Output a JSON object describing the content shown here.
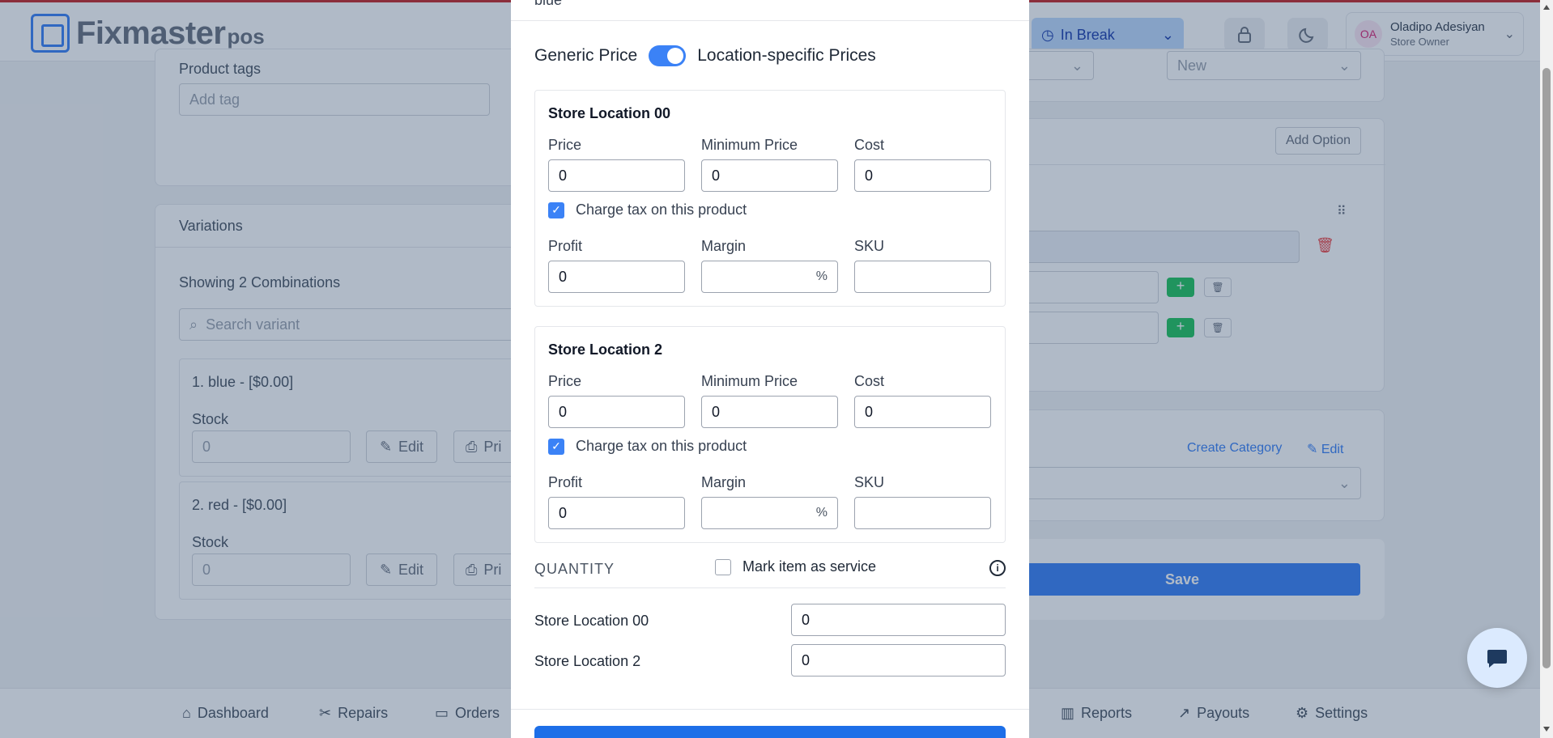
{
  "header": {
    "logo_text": "Fixmaster",
    "logo_suffix": "pos",
    "status": "In Break",
    "user": {
      "initials": "OA",
      "name": "Oladipo Adesiyan",
      "role": "Store Owner"
    }
  },
  "background": {
    "product_tags_label": "Product tags",
    "product_tags_placeholder": "Add tag",
    "condition_value": "New",
    "add_option_label": "Add Option",
    "variations_title": "Variations",
    "combinations_text": "Showing 2 Combinations",
    "search_placeholder": "Search variant",
    "variants": [
      {
        "name": "1. blue  -  [$0.00]",
        "stock_label": "Stock",
        "stock": "0",
        "edit": "Edit",
        "print": "Pri"
      },
      {
        "name": "2. red  -  [$0.00]",
        "stock_label": "Stock",
        "stock": "0",
        "edit": "Edit",
        "print": "Pri"
      }
    ],
    "create_category": "Create Category",
    "category_edit": "Edit",
    "save_label": "Save"
  },
  "bottom_nav": [
    "Dashboard",
    "Repairs",
    "Orders",
    "Reports",
    "Payouts",
    "Settings"
  ],
  "modal": {
    "head_cut": "blue",
    "toggle_left": "Generic Price",
    "toggle_right": "Location-specific Prices",
    "locations": [
      {
        "title": "Store Location 00",
        "price_label": "Price",
        "price": "0",
        "min_price_label": "Minimum Price",
        "min_price": "0",
        "cost_label": "Cost",
        "cost": "0",
        "tax_label": "Charge tax on this product",
        "profit_label": "Profit",
        "profit": "0",
        "margin_label": "Margin",
        "margin_suffix": "%",
        "sku_label": "SKU",
        "sku": ""
      },
      {
        "title": "Store Location 2",
        "price_label": "Price",
        "price": "0",
        "min_price_label": "Minimum Price",
        "min_price": "0",
        "cost_label": "Cost",
        "cost": "0",
        "tax_label": "Charge tax on this product",
        "profit_label": "Profit",
        "profit": "0",
        "margin_label": "Margin",
        "margin_suffix": "%",
        "sku_label": "SKU",
        "sku": ""
      }
    ],
    "quantity_title": "QUANTITY",
    "service_label": "Mark item as service",
    "quantities": [
      {
        "location": "Store Location 00",
        "value": "0"
      },
      {
        "location": "Store Location 2",
        "value": "0"
      }
    ]
  },
  "colors": {
    "accent": "#3b82f6",
    "primary_button": "#1d6fe8",
    "top_border": "#c62828"
  }
}
